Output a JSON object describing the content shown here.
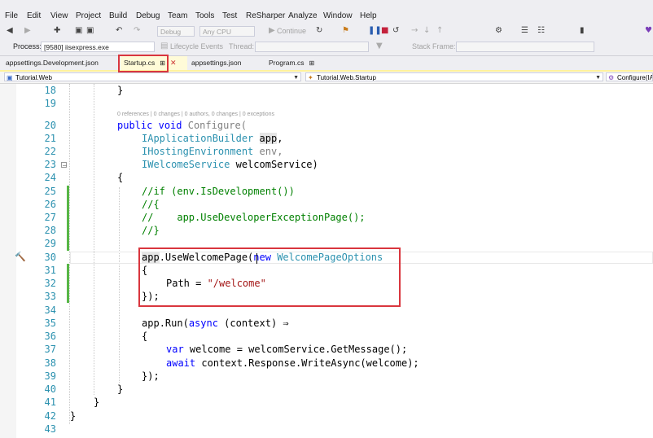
{
  "menu": {
    "file": "File",
    "edit": "Edit",
    "view": "View",
    "project": "Project",
    "build": "Build",
    "debug": "Debug",
    "team": "Team",
    "tools": "Tools",
    "test": "Test",
    "resharper": "ReSharper",
    "analyze": "Analyze",
    "window": "Window",
    "help": "Help"
  },
  "toolbar": {
    "config": "Debug",
    "platform": "Any CPU",
    "continue": "Continue"
  },
  "toolbar2": {
    "process_label": "Process:",
    "process_value": "[9580] iisexpress.exe",
    "lifecycle": "Lifecycle Events",
    "thread_label": "Thread:",
    "stackframe_label": "Stack Frame:"
  },
  "tabs": {
    "t1": "appsettings.Development.json",
    "t2": "Startup.cs",
    "t3": "appsettings.json",
    "t4": "Program.cs"
  },
  "nav": {
    "project": "Tutorial.Web",
    "class": "Tutorial.Web.Startup",
    "member": "Configure(IA"
  },
  "codelens": "0 references | 0 changes | 0 authors, 0 changes | 0 exceptions",
  "lines": {
    "l18": "18",
    "l19": "19",
    "l20": "20",
    "l21": "21",
    "l22": "22",
    "l23": "23",
    "l24": "24",
    "l25": "25",
    "l26": "26",
    "l27": "27",
    "l28": "28",
    "l29": "29",
    "l30": "30",
    "l31": "31",
    "l32": "32",
    "l33": "33",
    "l34": "34",
    "l35": "35",
    "l36": "36",
    "l37": "37",
    "l38": "38",
    "l39": "39",
    "l40": "40",
    "l41": "41",
    "l42": "42",
    "l43": "43"
  },
  "code": {
    "c18": "}",
    "c20a": "public",
    "c20b": "void",
    "c20c": "Configure(",
    "c21a": "IApplicationBuilder",
    "c21b": "app",
    ",c21c": ",",
    "c22a": "IHostingEnvironment",
    "c22b": "env,",
    "c23a": "IWelcomeService",
    "c23b": " welcomService)",
    "c24": "{",
    "c25": "//if (env.IsDevelopment())",
    "c26": "//{",
    "c27": "//    app.UseDeveloperExceptionPage();",
    "c28": "//}",
    "c30a": "app",
    ".c30b": ".UseWelcomePage(",
    "c30c": "new",
    "c30d": "WelcomePageOptions",
    "c31": "{",
    "c32a": "Path = ",
    "c32b": "\"/welcome\"",
    "c33": "});",
    "c35a": "app",
    ".c35b": ".Run(",
    "c35c": "async",
    "c35d": " (context) ⇒",
    "c36": "{",
    "c37a": "var",
    " c37b": " welcome = welcomService.GetMessage();",
    "c38a": "await",
    " c38b": " context.Response.WriteAsync(welcome);",
    "c39": "});",
    "c40": "}",
    "c41": "}",
    "c42": "}"
  }
}
